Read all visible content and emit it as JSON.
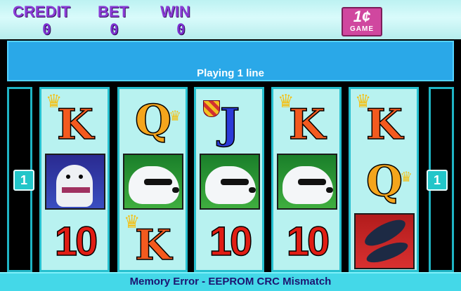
{
  "header": {
    "credit_label": "CREDIT",
    "credit_value": "0",
    "bet_label": "BET",
    "bet_value": "0",
    "win_label": "WIN",
    "win_value": "0",
    "logo_big": "1¢",
    "logo_small": "GAME"
  },
  "message": "Playing 1 line",
  "reels": [
    [
      "K",
      "polar-bear-cub-icon",
      "10"
    ],
    [
      "Q",
      "polar-bear-sunglasses-icon",
      "K"
    ],
    [
      "J",
      "polar-bear-sunglasses-icon",
      "10"
    ],
    [
      "K",
      "polar-bear-sunglasses-icon",
      "10"
    ],
    [
      "K",
      "Q",
      "whale-icon"
    ]
  ],
  "line_left": "1",
  "line_right": "1",
  "status": "Memory Error - EEPROM CRC Mismatch",
  "colors": {
    "accent": "#26c0cf",
    "panel": "#2aa8e8",
    "label": "#8a3cd6"
  }
}
